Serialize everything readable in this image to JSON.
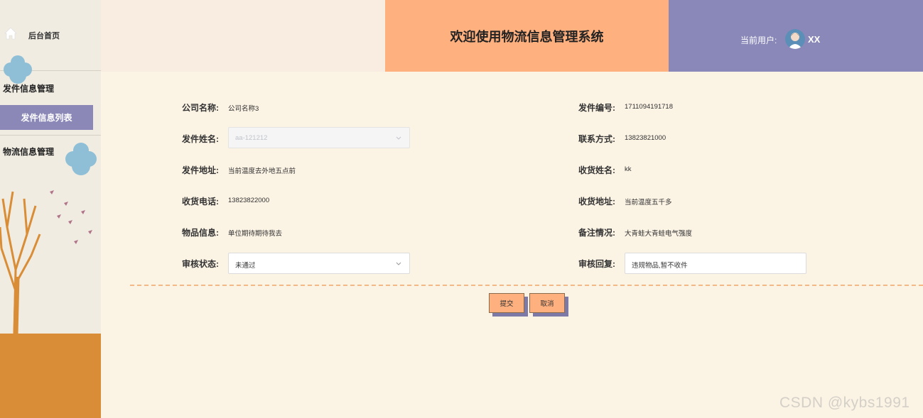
{
  "sidebar": {
    "home_label": "后台首页",
    "group1_label": "发件信息管理",
    "group1_sub_label": "发件信息列表",
    "group2_label": "物流信息管理"
  },
  "header": {
    "title": "欢迎使用物流信息管理系统",
    "user_label": "当前用户:",
    "user_name": "XX"
  },
  "form": {
    "company": {
      "label": "公司名称:",
      "value": "公司名称3"
    },
    "sender_no": {
      "label": "发件编号:",
      "value": "1711094191718"
    },
    "sender_name": {
      "label": "发件姓名:",
      "value": "aa-121212"
    },
    "contact": {
      "label": "联系方式:",
      "value": "13823821000"
    },
    "sender_addr": {
      "label": "发件地址:",
      "value": "当前温度去外地五点前"
    },
    "receiver_name": {
      "label": "收货姓名:",
      "value": "kk"
    },
    "receiver_phone": {
      "label": "收货电话:",
      "value": "13823822000"
    },
    "receiver_addr": {
      "label": "收货地址:",
      "value": "当前温度五千多"
    },
    "goods": {
      "label": "物品信息:",
      "value": "单位期待期待我去"
    },
    "remark": {
      "label": "备注情况:",
      "value": "大青蛙大青蛙电气强度"
    },
    "audit_status": {
      "label": "审核状态:",
      "value": "未通过"
    },
    "audit_reply": {
      "label": "审核回复:",
      "value": "违规物品,暂不收件"
    }
  },
  "buttons": {
    "submit": "提交",
    "cancel": "取消"
  },
  "watermark": "CSDN @kybs1991",
  "colors": {
    "accent_orange": "#ffb07f",
    "accent_purple": "#8a88b8",
    "background": "#fbf3e4",
    "ground": "#d98d36"
  }
}
